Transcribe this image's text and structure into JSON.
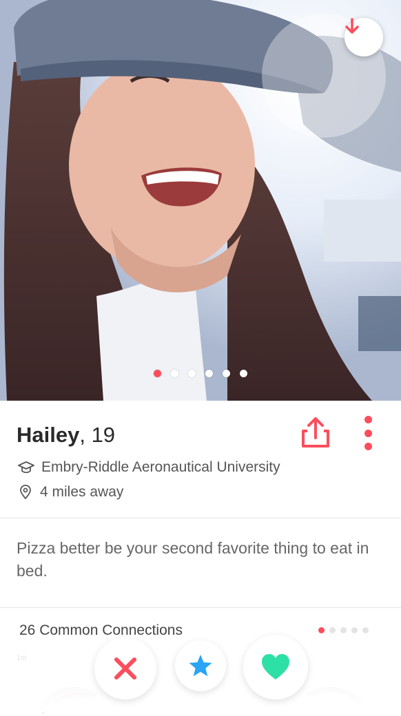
{
  "profile": {
    "name": "Hailey",
    "age_text": ", 19",
    "school": "Embry-Riddle Aeronautical University",
    "distance": "4 miles away",
    "bio": "Pizza better be your second favorite thing to eat in bed.",
    "photo_count": 6,
    "active_photo_index": 0
  },
  "connections": {
    "title": "26 Common Connections",
    "degree_tag": "1st",
    "page_count": 5,
    "active_page_index": 0
  },
  "icons": {
    "collapse": "arrow-down-icon",
    "share": "share-icon",
    "more": "more-vertical-icon",
    "school": "graduation-cap-icon",
    "location": "location-pin-icon",
    "nope": "close-icon",
    "super_like": "star-icon",
    "like": "heart-icon"
  },
  "colors": {
    "accent": "#fd4d5c",
    "nope": "#fd4d5c",
    "super_like": "#2aa4f4",
    "like": "#2de0a5"
  }
}
